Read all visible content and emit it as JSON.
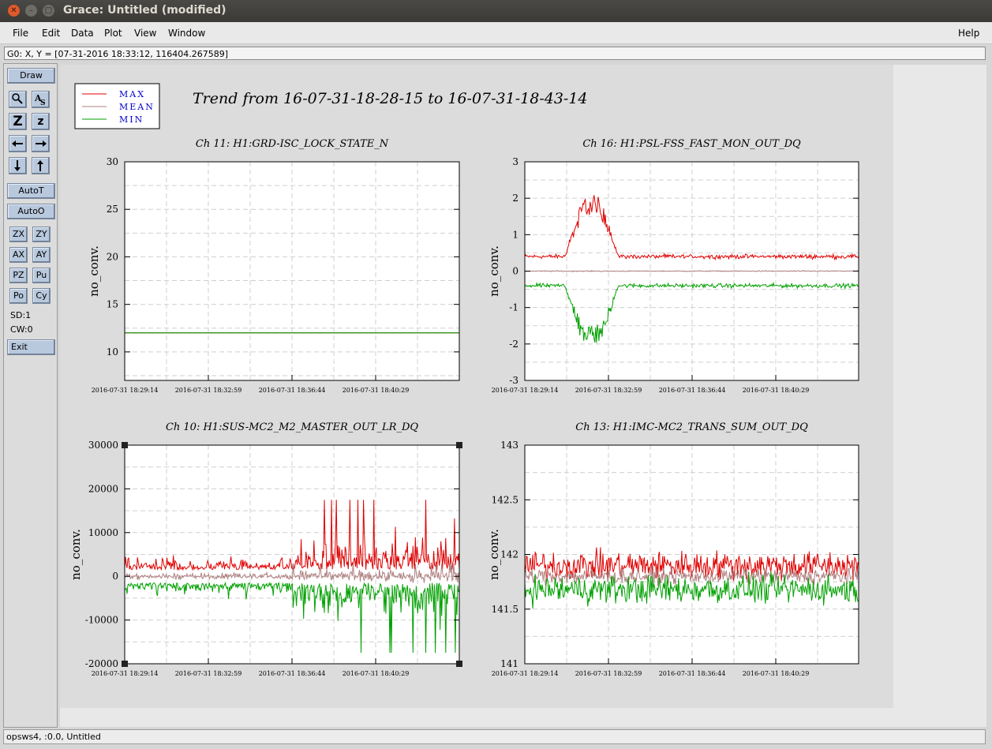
{
  "window": {
    "title": "Grace: Untitled (modified)"
  },
  "menu": {
    "file": "File",
    "edit": "Edit",
    "data": "Data",
    "plot": "Plot",
    "view": "View",
    "window": "Window",
    "help": "Help"
  },
  "locator": "G0: X, Y = [07-31-2016 18:33:12, 116404.267589]",
  "toolbox": {
    "draw": "Draw",
    "autot": "AutoT",
    "autoo": "AutoO",
    "zx": "ZX",
    "zy": "ZY",
    "ax": "AX",
    "ay": "AY",
    "pz": "PZ",
    "pu": "Pu",
    "po": "Po",
    "cy": "Cy",
    "sd": "SD:1",
    "cw": "CW:0",
    "exit": "Exit",
    "zoom_big": "Z",
    "zoom_small": "z"
  },
  "status": "opsws4, :0.0, Untitled",
  "legend": [
    {
      "label": "MAX",
      "color": "#e00000"
    },
    {
      "label": "MEAN",
      "color": "#b08080"
    },
    {
      "label": "MIN",
      "color": "#00a000"
    }
  ],
  "page_title": "Trend from 16-07-31-18-28-15 to 16-07-31-18-43-14",
  "chart_data": [
    {
      "type": "line",
      "title": "Ch 11: H1:GRD-ISC_LOCK_STATE_N",
      "ylabel": "no_conv.",
      "ylim": [
        7,
        30
      ],
      "yticks": [
        10,
        15,
        20,
        25,
        30
      ],
      "xticks": [
        "2016-07-31 18:29:14",
        "2016-07-31 18:32:59",
        "2016-07-31 18:36:44",
        "2016-07-31 18:40:29"
      ],
      "series": [
        {
          "name": "MAX",
          "color": "#e00000",
          "constant": 12
        },
        {
          "name": "MEAN",
          "color": "#b08080",
          "constant": 12
        },
        {
          "name": "MIN",
          "color": "#00a000",
          "constant": 12
        }
      ]
    },
    {
      "type": "line",
      "title": "Ch 16: H1:PSL-FSS_FAST_MON_OUT_DQ",
      "ylabel": "no_conv.",
      "ylim": [
        -3,
        3
      ],
      "yticks": [
        -3,
        -2,
        -1,
        0,
        1,
        2,
        3
      ],
      "xticks": [
        "2016-07-31 18:29:14",
        "2016-07-31 18:32:59",
        "2016-07-31 18:36:44",
        "2016-07-31 18:40:29"
      ],
      "series": [
        {
          "name": "MAX",
          "color": "#e00000",
          "base": 0.4,
          "noise": 0.04,
          "bump": 1.5
        },
        {
          "name": "MEAN",
          "color": "#b08080",
          "base": 0.0,
          "noise": 0.01,
          "bump": 0
        },
        {
          "name": "MIN",
          "color": "#00a000",
          "base": -0.4,
          "noise": 0.04,
          "bump": -1.5
        }
      ]
    },
    {
      "type": "line",
      "title": "Ch 10: H1:SUS-MC2_M2_MASTER_OUT_LR_DQ",
      "ylabel": "no_conv.",
      "ylim": [
        -20000,
        30000
      ],
      "yticks": [
        -20000,
        -10000,
        0,
        10000,
        20000,
        30000
      ],
      "xticks": [
        "2016-07-31 18:29:14",
        "2016-07-31 18:32:59",
        "2016-07-31 18:36:44",
        "2016-07-31 18:40:29"
      ],
      "series": [
        {
          "name": "MAX",
          "color": "#e00000",
          "base": 1500,
          "noise": 1800,
          "late_noise": 5000
        },
        {
          "name": "MEAN",
          "color": "#b08080",
          "base": 0,
          "noise": 500,
          "late_noise": 900
        },
        {
          "name": "MIN",
          "color": "#00a000",
          "base": -1500,
          "noise": 1800,
          "late_noise": 5000
        }
      ]
    },
    {
      "type": "line",
      "title": "Ch 13: H1:IMC-MC2_TRANS_SUM_OUT_DQ",
      "ylabel": "no_conv.",
      "ylim": [
        141,
        143
      ],
      "yticks": [
        141,
        141.5,
        142,
        142.5,
        143
      ],
      "xticks": [
        "2016-07-31 18:29:14",
        "2016-07-31 18:32:59",
        "2016-07-31 18:36:44",
        "2016-07-31 18:40:29"
      ],
      "series": [
        {
          "name": "MAX",
          "color": "#e00000",
          "base": 141.9,
          "noise": 0.09
        },
        {
          "name": "MEAN",
          "color": "#b08080",
          "base": 141.8,
          "noise": 0.05
        },
        {
          "name": "MIN",
          "color": "#00a000",
          "base": 141.68,
          "noise": 0.09
        }
      ]
    }
  ]
}
